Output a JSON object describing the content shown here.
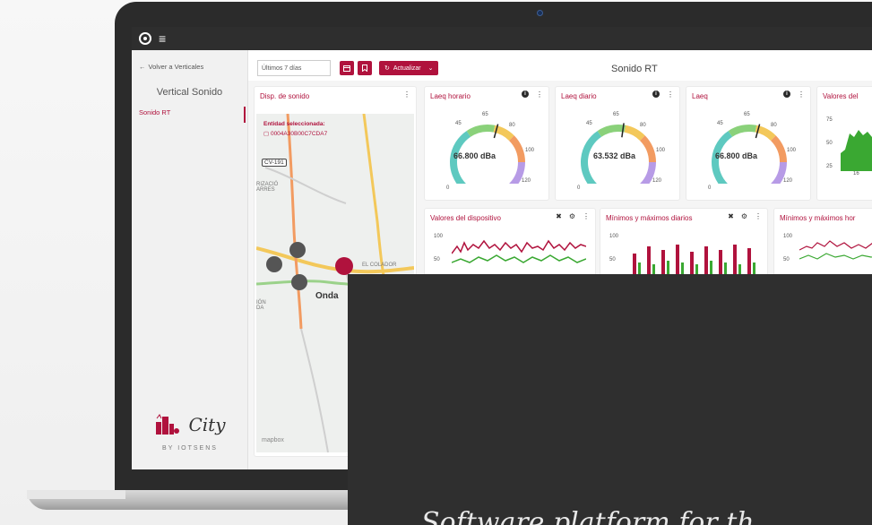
{
  "app": {
    "logo_icon": "logo-circle-icon",
    "menu_icon": "hamburger-icon"
  },
  "sidebar": {
    "back_label": "Volver a Verticales",
    "vertical_title": "Vertical Sonido",
    "items": [
      {
        "label": "Sonido RT",
        "active": true
      }
    ],
    "brand_name": "City",
    "brand_by": "BY IOTSENS"
  },
  "toolbar": {
    "date_value": "Últimos 7 días",
    "calendar_icon": "calendar-icon",
    "bookmark_icon": "bookmark-icon",
    "update_label": "Actualizar",
    "page_title": "Sonido RT"
  },
  "map_card": {
    "title": "Disp. de sonido",
    "entity_label": "Entidad seleccionada:",
    "entity_id": "0004A30B00C7CDA7",
    "road_label": "CV-191",
    "place_labels": [
      "Onda",
      "EL COLADOR",
      "RIZACIÓ ARRES",
      "IÓN DA"
    ],
    "attribution": "mapbox"
  },
  "gauges": [
    {
      "title": "Laeq horario",
      "value": "66.800 dBa",
      "level": 66.8
    },
    {
      "title": "Laeq diario",
      "value": "63.532 dBa",
      "level": 63.532
    },
    {
      "title": "Laeq",
      "value": "66.800 dBa",
      "level": 66.8
    }
  ],
  "gauge_ticks": [
    "0",
    "45",
    "65",
    "80",
    "100",
    "120"
  ],
  "partial_card": {
    "title": "Valores del",
    "ticks": [
      "75",
      "50",
      "25",
      "16"
    ]
  },
  "chart_cards": [
    {
      "title": "Valores del dispositivo",
      "ticks": [
        "100",
        "50"
      ]
    },
    {
      "title": "Mínimos y máximos diarios",
      "ticks": [
        "100",
        "50"
      ]
    },
    {
      "title": "Mínimos y máximos hor",
      "ticks": [
        "100",
        "50"
      ]
    }
  ],
  "colors": {
    "accent": "#b0123d",
    "topbar": "#2e2e2e",
    "overlay": "#2f2f2f"
  },
  "overlay": {
    "text": "Software platform for th"
  }
}
